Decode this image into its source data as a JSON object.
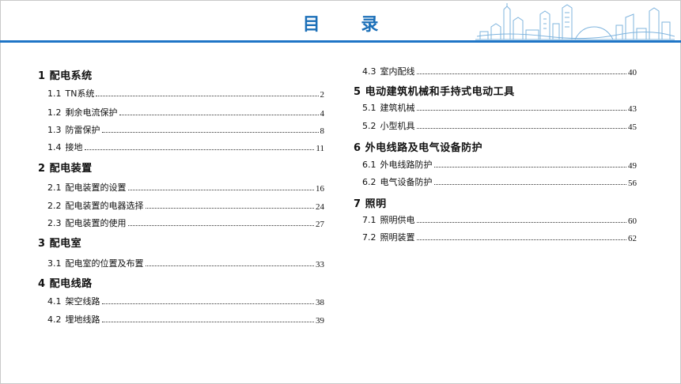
{
  "title": "目 录",
  "left_column": [
    {
      "chapter": "1 配电系统",
      "sections": [
        {
          "num": "1.1",
          "title": "TN系统",
          "page": "2"
        },
        {
          "num": "1.2",
          "title": "剩余电流保护",
          "page": "4"
        },
        {
          "num": "1.3",
          "title": "防雷保护",
          "page": "8"
        },
        {
          "num": "1.4",
          "title": "接地",
          "page": "11"
        }
      ]
    },
    {
      "chapter": "2 配电装置",
      "sections": [
        {
          "num": "2.1",
          "title": "配电装置的设置",
          "page": "16"
        },
        {
          "num": "2.2",
          "title": "配电装置的电器选择",
          "page": "24"
        },
        {
          "num": "2.3",
          "title": "配电装置的使用",
          "page": "27"
        }
      ]
    },
    {
      "chapter": "3 配电室",
      "sections": [
        {
          "num": "3.1",
          "title": "配电室的位置及布置",
          "page": "33"
        }
      ]
    },
    {
      "chapter": "4 配电线路",
      "sections": [
        {
          "num": "4.1",
          "title": "架空线路",
          "page": "38"
        },
        {
          "num": "4.2",
          "title": "埋地线路",
          "page": "39"
        }
      ]
    }
  ],
  "right_column_top": {
    "num": "4.3",
    "title": "室内配线",
    "page": "40"
  },
  "right_column": [
    {
      "chapter": "5 电动建筑机械和手持式电动工具",
      "sections": [
        {
          "num": "5.1",
          "title": "建筑机械",
          "page": "43"
        },
        {
          "num": "5.2",
          "title": "小型机具",
          "page": "45"
        }
      ]
    },
    {
      "chapter": "6 外电线路及电气设备防护",
      "sections": [
        {
          "num": "6.1",
          "title": "外电线路防护",
          "page": "49"
        },
        {
          "num": "6.2",
          "title": "电气设备防护",
          "page": "56"
        }
      ]
    },
    {
      "chapter": "7 照明",
      "sections": [
        {
          "num": "7.1",
          "title": "照明供电",
          "page": "60"
        },
        {
          "num": "7.2",
          "title": "照明装置",
          "page": "62"
        }
      ]
    }
  ],
  "colors": {
    "accent": "#1f75c6",
    "title": "#1b6fb8",
    "skyline": "#7fb4de"
  },
  "decoration": "city-skyline-illustration"
}
